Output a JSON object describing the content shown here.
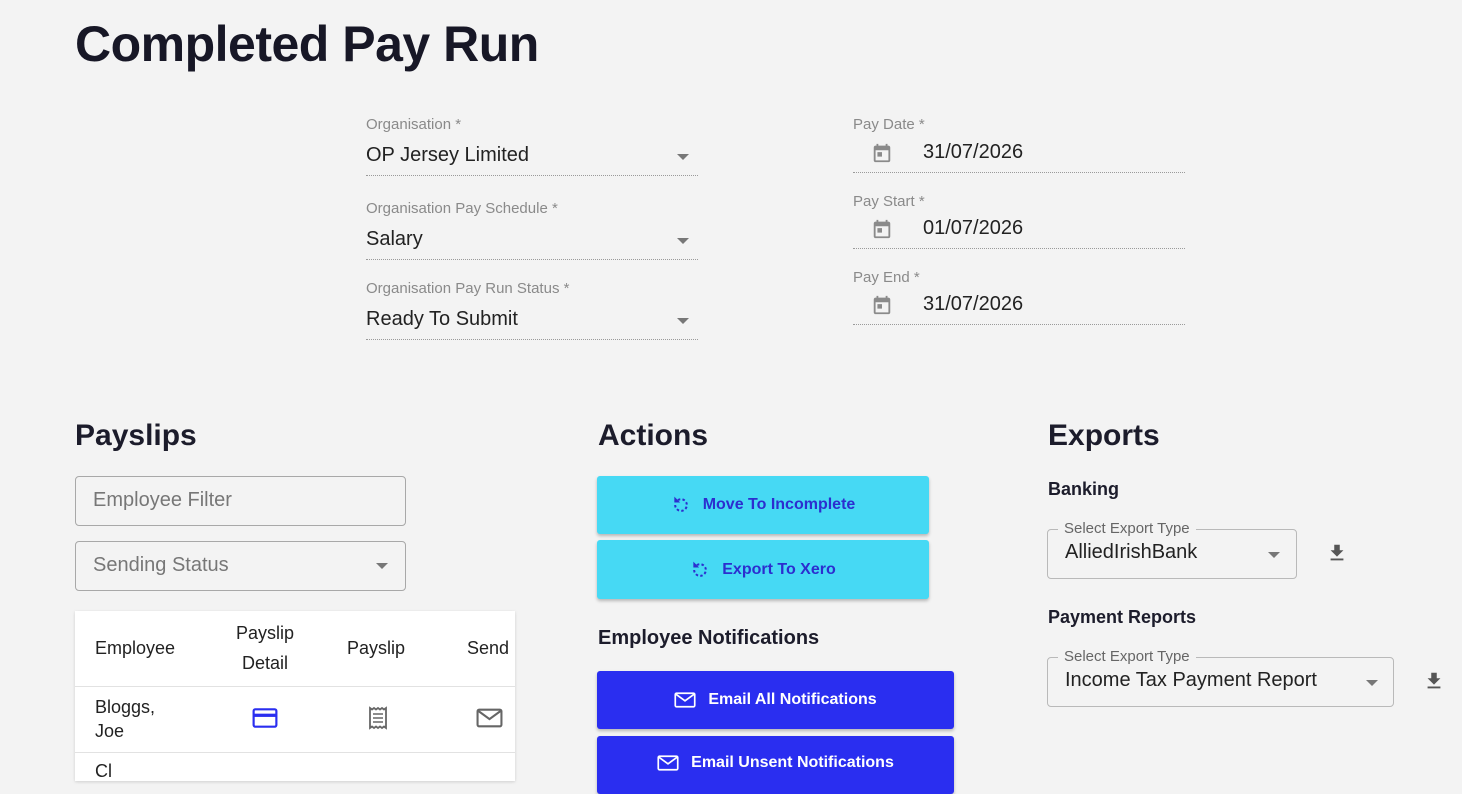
{
  "page": {
    "title": "Completed Pay Run"
  },
  "form": {
    "organisation": {
      "label": "Organisation *",
      "value": "OP Jersey Limited"
    },
    "pay_schedule": {
      "label": "Organisation Pay Schedule *",
      "value": "Salary"
    },
    "pay_run_status": {
      "label": "Organisation Pay Run Status *",
      "value": "Ready To Submit"
    },
    "pay_date": {
      "label": "Pay Date *",
      "value": "31/07/2026"
    },
    "pay_start": {
      "label": "Pay Start *",
      "value": "01/07/2026"
    },
    "pay_end": {
      "label": "Pay End *",
      "value": "31/07/2026"
    }
  },
  "payslips": {
    "heading": "Payslips",
    "employee_filter_placeholder": "Employee Filter",
    "sending_status_placeholder": "Sending Status",
    "columns": [
      "Employee",
      "Payslip Detail",
      "Payslip",
      "Send"
    ],
    "rows": [
      {
        "employee": "Bloggs, Joe",
        "icons": [
          "credit-card-icon",
          "receipt-icon",
          "mail-icon"
        ]
      },
      {
        "employee": "Cl"
      }
    ]
  },
  "actions": {
    "heading": "Actions",
    "move_to_incomplete": "Move To Incomplete",
    "export_to_xero": "Export To Xero",
    "notifications_heading": "Employee Notifications",
    "email_all": "Email All Notifications",
    "email_unsent": "Email Unsent Notifications"
  },
  "exports": {
    "heading": "Exports",
    "banking": {
      "heading": "Banking",
      "legend": "Select Export Type",
      "value": "AlliedIrishBank"
    },
    "payment_reports": {
      "heading": "Payment Reports",
      "legend": "Select Export Type",
      "value": "Income Tax Payment Report"
    }
  },
  "colors": {
    "cyan_button": "#46d9f4",
    "blue_button": "#2a2ef0",
    "icon_blue": "#2a2ef0",
    "background": "#f3f3f3"
  }
}
